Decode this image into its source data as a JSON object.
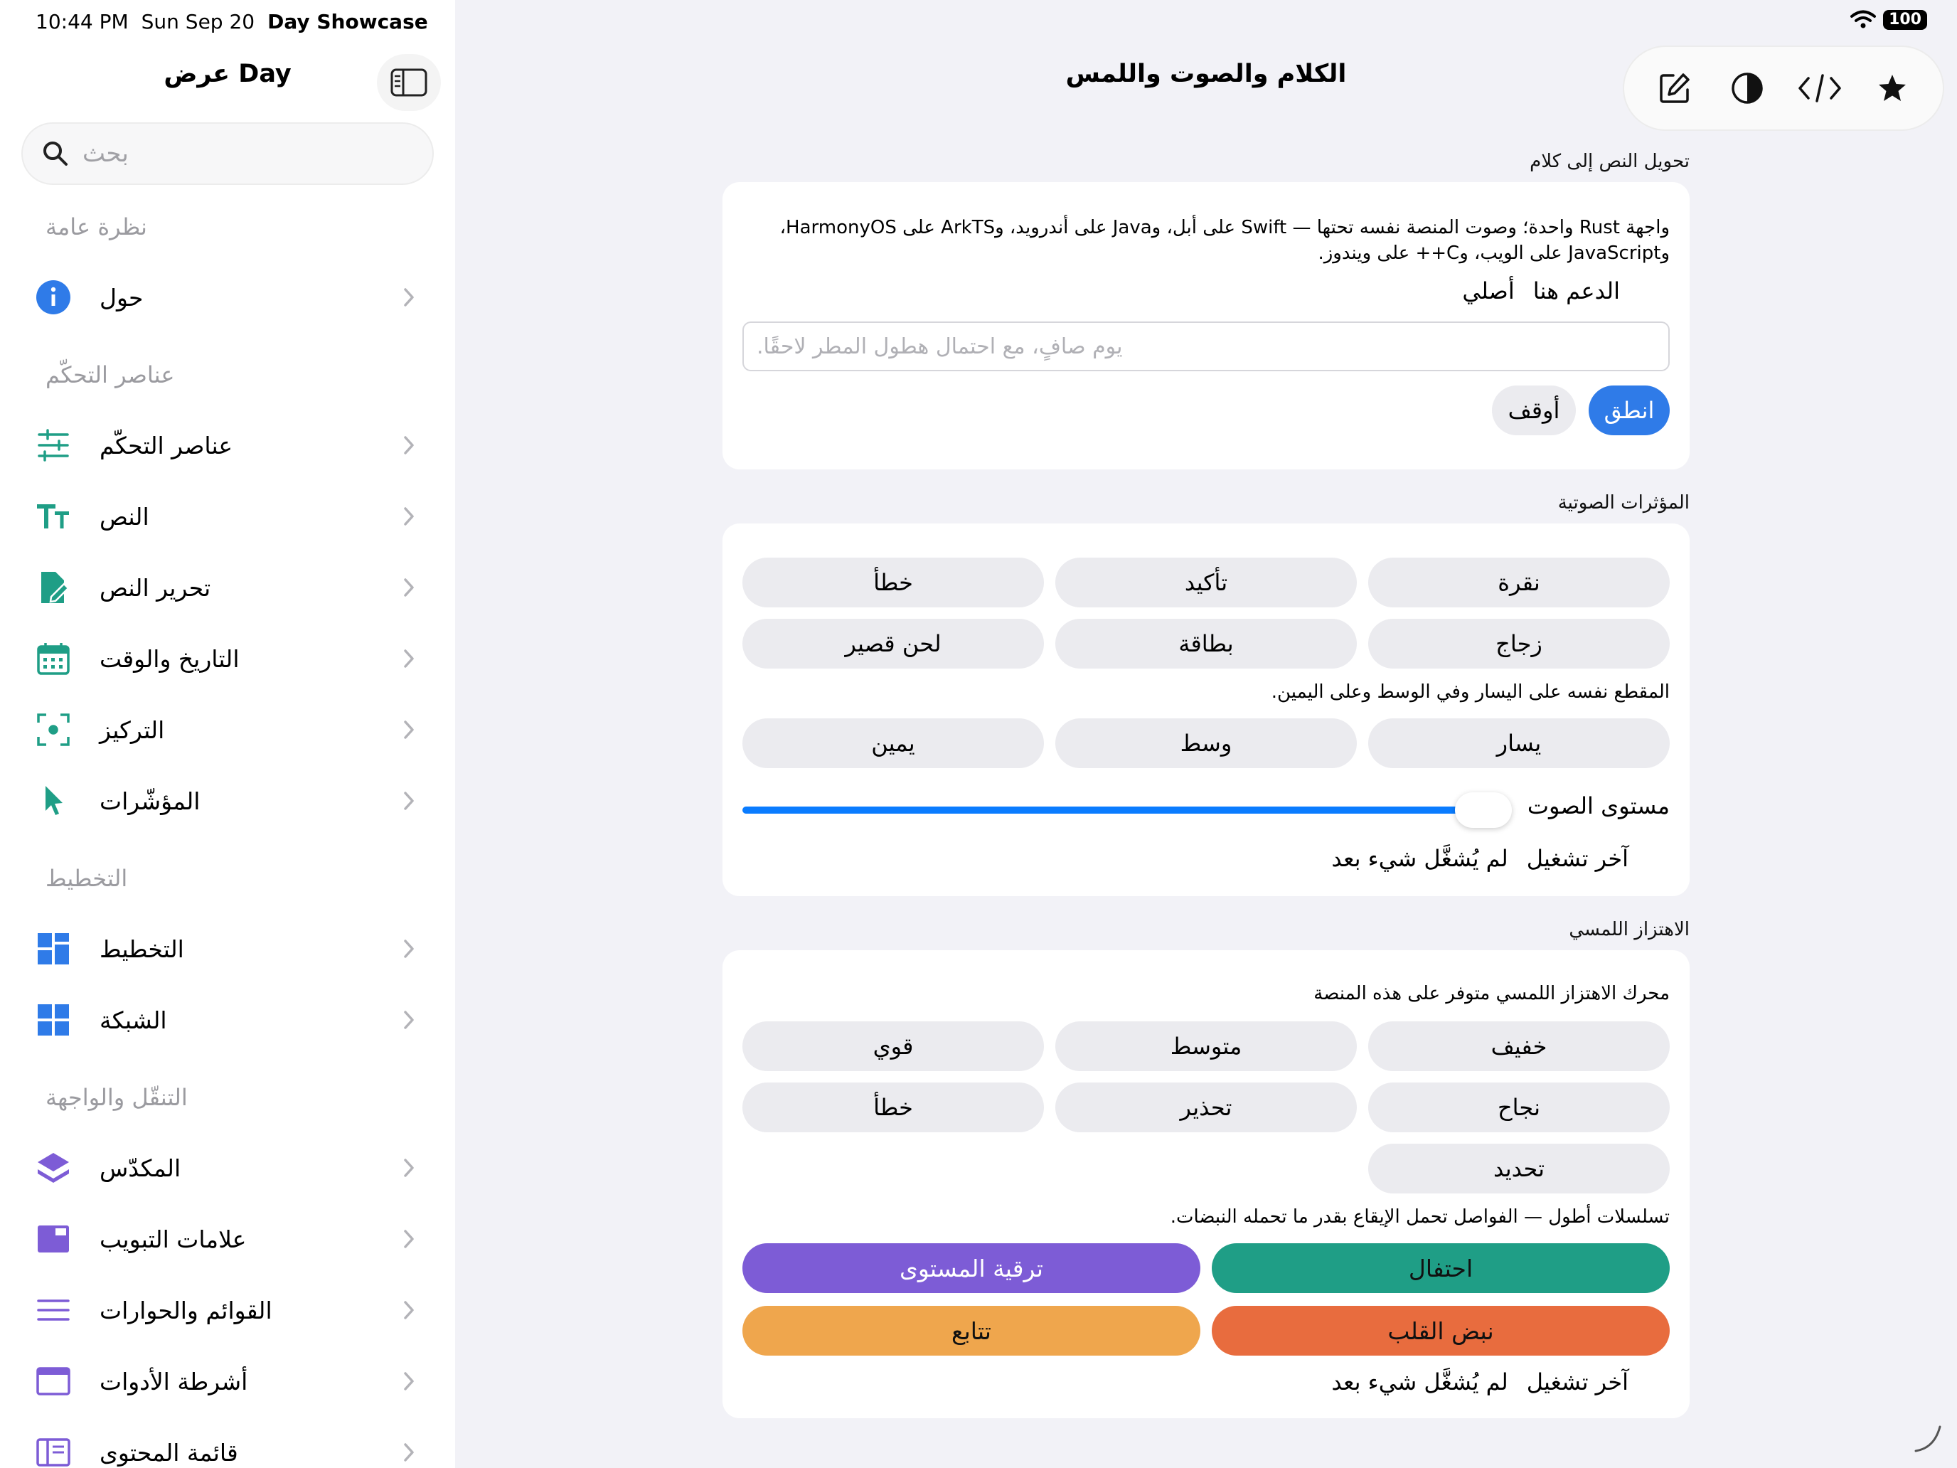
{
  "status_bar": {
    "time": "10:44 PM",
    "date": "Sun Sep 20",
    "app": "Day Showcase",
    "battery": "100"
  },
  "sidebar": {
    "title": "عرض Day",
    "search_placeholder": "بحث",
    "sections": [
      {
        "header": "نظرة عامة",
        "items": [
          {
            "label": "حول",
            "icon": "info-icon"
          }
        ]
      },
      {
        "header": "عناصر التحكّم",
        "items": [
          {
            "label": "عناصر التحكّم",
            "icon": "sliders-icon"
          },
          {
            "label": "النص",
            "icon": "text-format-icon"
          },
          {
            "label": "تحرير النص",
            "icon": "edit-document-icon"
          },
          {
            "label": "التاريخ والوقت",
            "icon": "calendar-icon"
          },
          {
            "label": "التركيز",
            "icon": "focus-icon"
          },
          {
            "label": "المؤشّرات",
            "icon": "pointer-icon"
          }
        ]
      },
      {
        "header": "التخطيط",
        "items": [
          {
            "label": "التخطيط",
            "icon": "layout-icon"
          },
          {
            "label": "الشبكة",
            "icon": "grid-icon"
          }
        ]
      },
      {
        "header": "التنقّل والواجهة",
        "items": [
          {
            "label": "المكدّس",
            "icon": "stack-icon"
          },
          {
            "label": "علامات التبويب",
            "icon": "tabs-icon"
          },
          {
            "label": "القوائم والحوارات",
            "icon": "menu-icon"
          },
          {
            "label": "أشرطة الأدوات",
            "icon": "toolbar-icon"
          },
          {
            "label": "قائمة المحتوى",
            "icon": "sidebar-list-icon"
          }
        ]
      }
    ]
  },
  "main": {
    "title": "الكلام والصوت واللمس",
    "toolbar": [
      "compose-icon",
      "contrast-icon",
      "code-icon",
      "star-icon"
    ],
    "tts": {
      "section_title": "تحويل النص إلى كلام",
      "description_line1": "واجهة Rust واحدة؛ وصوت المنصة نفسه تحتها — Swift على أبل، وJava على أندرويد، وArkTS على HarmonyOS،",
      "description_line2": "وJavaScript على الويب، وC++ على ويندوز.",
      "support_label": "الدعم هنا",
      "support_value": "أصلي",
      "input_placeholder": "يوم صافٍ، مع احتمال هطول المطر لاحقًا.",
      "speak_label": "انطق",
      "stop_label": "أوقف"
    },
    "sound": {
      "section_title": "المؤثرات الصوتية",
      "effects": [
        "نقرة",
        "تأكيد",
        "خطأ",
        "زجاج",
        "بطاقة",
        "لحن قصير"
      ],
      "pan_note": "المقطع نفسه على اليسار وفي الوسط وعلى اليمين.",
      "pans": [
        "يسار",
        "وسط",
        "يمين"
      ],
      "volume_label": "مستوى الصوت",
      "volume_level": 0.95,
      "last_played_label": "آخر تشغيل",
      "last_played_value": "لم يُشغَّل شيء بعد"
    },
    "haptics": {
      "section_title": "الاهتزاز اللمسي",
      "engine_note": "محرك الاهتزاز اللمسي متوفر على هذه المنصة",
      "impacts": [
        "خفيف",
        "متوسط",
        "قوي",
        "نجاح",
        "تحذير",
        "خطأ",
        "تحديد"
      ],
      "patterns_note": "تسلسلات أطول — الفواصل تحمل الإيقاع بقدر ما تحمله النبضات.",
      "patterns": [
        {
          "label": "احتفال",
          "color": "#1f9e86"
        },
        {
          "label": "ترقية المستوى",
          "color": "#7d5cd6"
        },
        {
          "label": "نبض القلب",
          "color": "#e86c3e"
        },
        {
          "label": "تتابع",
          "color": "#efa64d"
        }
      ],
      "last_played_label": "آخر تشغيل",
      "last_played_value": "لم يُشغَّل شيء بعد"
    }
  },
  "colors": {
    "accent": "#2f7be8",
    "teal": "#1f9e86",
    "slider": "#0a7cff"
  }
}
